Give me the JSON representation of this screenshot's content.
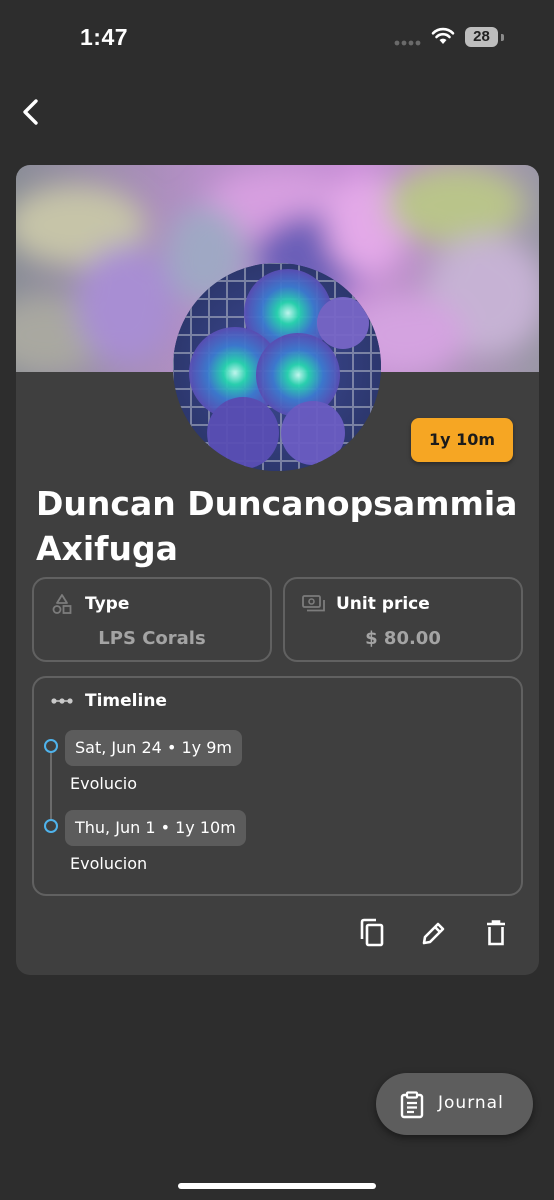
{
  "status_bar": {
    "time": "1:47",
    "battery": "28"
  },
  "coral": {
    "age_badge": "1y 10m",
    "name": "Duncan Duncanopsammia Axifuga",
    "type_label": "Type",
    "type_value": "LPS Corals",
    "price_label": "Unit price",
    "price_value": "$ 80.00"
  },
  "timeline": {
    "title": "Timeline",
    "entries": [
      {
        "date": "Sat, Jun 24 • 1y 9m",
        "note": "Evolucio"
      },
      {
        "date": "Thu, Jun 1 • 1y 10m",
        "note": "Evolucion"
      }
    ]
  },
  "journal_button": {
    "label": "Journal"
  },
  "colors": {
    "background": "#2d2d2d",
    "card": "#3f3f3f",
    "accent": "#f6a623",
    "timeline_dot": "#4fb3ec"
  }
}
